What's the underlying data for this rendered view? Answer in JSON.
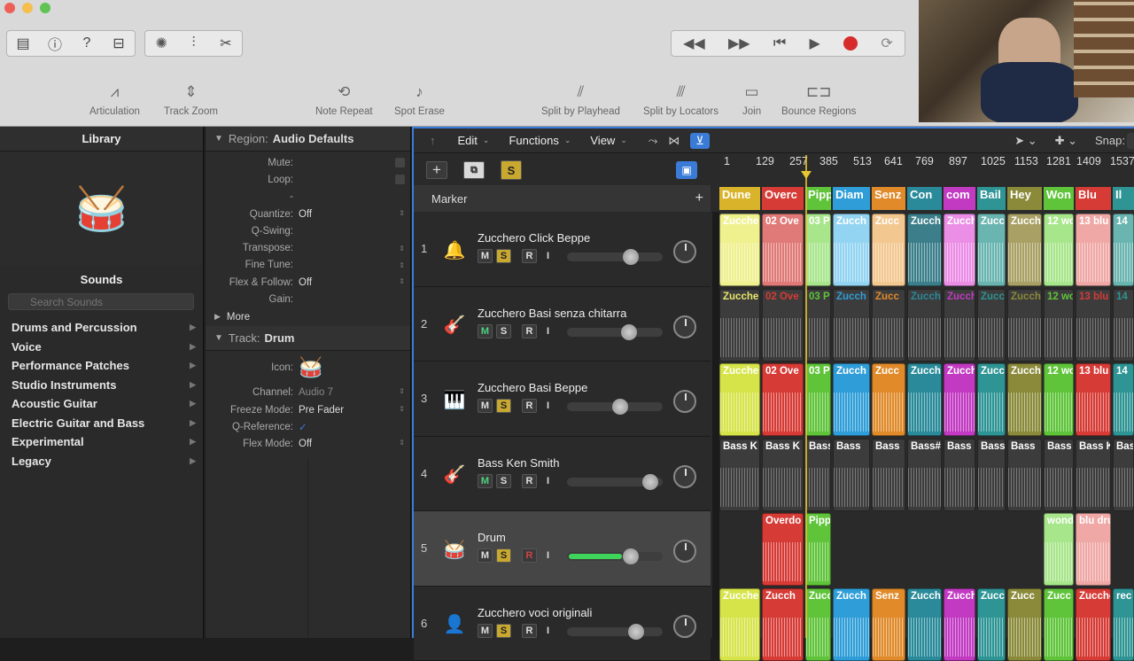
{
  "window": {
    "traffic": [
      "close",
      "minimize",
      "zoom"
    ]
  },
  "toolbar": {
    "left_icons": [
      "library-icon",
      "info-icon",
      "help-icon",
      "toolbar-icon",
      "smart-controls-icon",
      "mixer-icon",
      "editors-icon"
    ],
    "transport_icons": [
      "rewind-icon",
      "fast-forward-icon",
      "go-to-start-icon",
      "play-icon",
      "record-icon",
      "cycle-icon"
    ],
    "controls": [
      {
        "label": "Articulation",
        "icon": "articulation-icon"
      },
      {
        "label": "Track Zoom",
        "icon": "track-zoom-icon"
      },
      {
        "label": "Note Repeat",
        "icon": "note-repeat-icon"
      },
      {
        "label": "Spot Erase",
        "icon": "spot-erase-icon"
      },
      {
        "label": "Split by Playhead",
        "icon": "split-playhead-icon"
      },
      {
        "label": "Split by Locators",
        "icon": "split-locators-icon"
      },
      {
        "label": "Join",
        "icon": "join-icon"
      },
      {
        "label": "Bounce Regions",
        "icon": "bounce-regions-icon"
      }
    ]
  },
  "library": {
    "title": "Library",
    "sounds_title": "Sounds",
    "search_placeholder": "Search Sounds",
    "items": [
      "Drums and Percussion",
      "Voice",
      "Performance Patches",
      "Studio Instruments",
      "Acoustic Guitar",
      "Electric Guitar and Bass",
      "Experimental",
      "Legacy"
    ]
  },
  "inspector": {
    "region_label": "Region:",
    "region_name": "Audio Defaults",
    "region_rows": [
      {
        "k": "Mute:",
        "v": ""
      },
      {
        "k": "Loop:",
        "v": ""
      },
      {
        "k": "-",
        "v": ""
      },
      {
        "k": "Quantize:",
        "v": "Off"
      },
      {
        "k": "Q-Swing:",
        "v": ""
      },
      {
        "k": "Transpose:",
        "v": ""
      },
      {
        "k": "Fine Tune:",
        "v": ""
      },
      {
        "k": "Flex & Follow:",
        "v": "Off"
      },
      {
        "k": "Gain:",
        "v": ""
      }
    ],
    "more": "More",
    "track_label": "Track:",
    "track_name": "Drum",
    "icon_label": "Icon:",
    "track_rows": [
      {
        "k": "Channel:",
        "v": "Audio 7"
      },
      {
        "k": "Freeze Mode:",
        "v": "Pre Fader"
      },
      {
        "k": "Q-Reference:",
        "v": "✓"
      },
      {
        "k": "Flex Mode:",
        "v": "Off"
      }
    ]
  },
  "tracks_area": {
    "menus": [
      "Edit",
      "Functions",
      "View"
    ],
    "snap_label": "Snap:",
    "marker_label": "Marker",
    "ruler": [
      "1",
      "129",
      "257",
      "385",
      "513",
      "641",
      "769",
      "897",
      "1025",
      "1153",
      "1281",
      "1409",
      "1537"
    ],
    "markers": [
      {
        "t": "Dune",
        "c": "#d9b42a"
      },
      {
        "t": "Overc",
        "c": "#d63b36"
      },
      {
        "t": "Pipp",
        "c": "#5fc43a"
      },
      {
        "t": "Diam",
        "c": "#2f9ed8"
      },
      {
        "t": "Senz",
        "c": "#e08a2a"
      },
      {
        "t": "Con",
        "c": "#2a8a9a"
      },
      {
        "t": "com",
        "c": "#c23ac2"
      },
      {
        "t": "Bail",
        "c": "#2e9494"
      },
      {
        "t": "Hey",
        "c": "#8a8a3a"
      },
      {
        "t": "Won",
        "c": "#5fc43a"
      },
      {
        "t": "Blu",
        "c": "#d63b36"
      },
      {
        "t": "Il",
        "c": "#2e9494"
      }
    ],
    "tracks": [
      {
        "num": "1",
        "name": "Zucchero Click Beppe",
        "icon": "metronome-icon",
        "m": "M",
        "s": "S",
        "r": "R",
        "i": "I",
        "solo": true,
        "mgreen": false,
        "rred": false,
        "vol": 0.72
      },
      {
        "num": "2",
        "name": "Zucchero Basi senza chitarra",
        "icon": "guitar-icon",
        "m": "M",
        "s": "S",
        "r": "R",
        "i": "I",
        "solo": false,
        "mgreen": true,
        "rred": false,
        "vol": 0.7
      },
      {
        "num": "3",
        "name": "Zucchero Basi Beppe",
        "icon": "keyboard-icon",
        "m": "M",
        "s": "S",
        "r": "R",
        "i": "I",
        "solo": true,
        "mgreen": false,
        "rred": false,
        "vol": 0.6
      },
      {
        "num": "4",
        "name": "Bass Ken Smith",
        "icon": "bass-icon",
        "m": "M",
        "s": "S",
        "r": "R",
        "i": "I",
        "solo": false,
        "mgreen": true,
        "rred": false,
        "vol": 0.94
      },
      {
        "num": "5",
        "name": "Drum",
        "icon": "drum-kit-icon",
        "m": "M",
        "s": "S",
        "r": "R",
        "i": "I",
        "solo": true,
        "mgreen": false,
        "rred": true,
        "vol": 0.72
      },
      {
        "num": "6",
        "name": "Zucchero voci originali",
        "icon": "voice-icon",
        "m": "M",
        "s": "S",
        "r": "R",
        "i": "I",
        "solo": true,
        "mgreen": false,
        "rred": false,
        "vol": 0.78
      }
    ],
    "regions": [
      {
        "row": 0,
        "items": [
          "Zucche",
          "02 Ove",
          "03 Pi",
          "Zucch",
          "Zucc",
          "Zucch",
          "Zucch",
          "Zucc",
          "Zucch",
          "12 wo",
          "13 blu",
          "14"
        ]
      },
      {
        "row": 1,
        "items": [
          "Zucche",
          "02 Ove",
          "03 Pi",
          "Zucch",
          "Zucc",
          "Zucch",
          "Zucch",
          "Zucc",
          "Zucch",
          "12 wo",
          "13 blu b",
          "14"
        ]
      },
      {
        "row": 2,
        "items": [
          "Zucche",
          "02 Ove",
          "03 Pi",
          "Zucch",
          "Zucc",
          "Zucch",
          "Zucch",
          "Zucc",
          "Zucch",
          "12 wo",
          "13 blu",
          "14"
        ]
      },
      {
        "row": 3,
        "items": [
          "Bass K",
          "Bass K",
          "Bass",
          "Bass",
          "Bass",
          "Bass#",
          "Bass",
          "Bass",
          "Bass",
          "Bass",
          "Bass K",
          "Bas"
        ]
      },
      {
        "row": 4,
        "items": [
          "",
          "Overdo",
          "Pipp",
          "",
          "",
          "",
          "",
          "",
          "",
          "wonde",
          "blu dru",
          ""
        ]
      },
      {
        "row": 5,
        "items": [
          "Zucche",
          "Zucch",
          "Zucc",
          "Zucch",
          "Senz",
          "Zucch",
          "Zucch",
          "Zucc",
          "Zucc",
          "Zucc",
          "Zucche",
          "rec"
        ]
      }
    ]
  }
}
